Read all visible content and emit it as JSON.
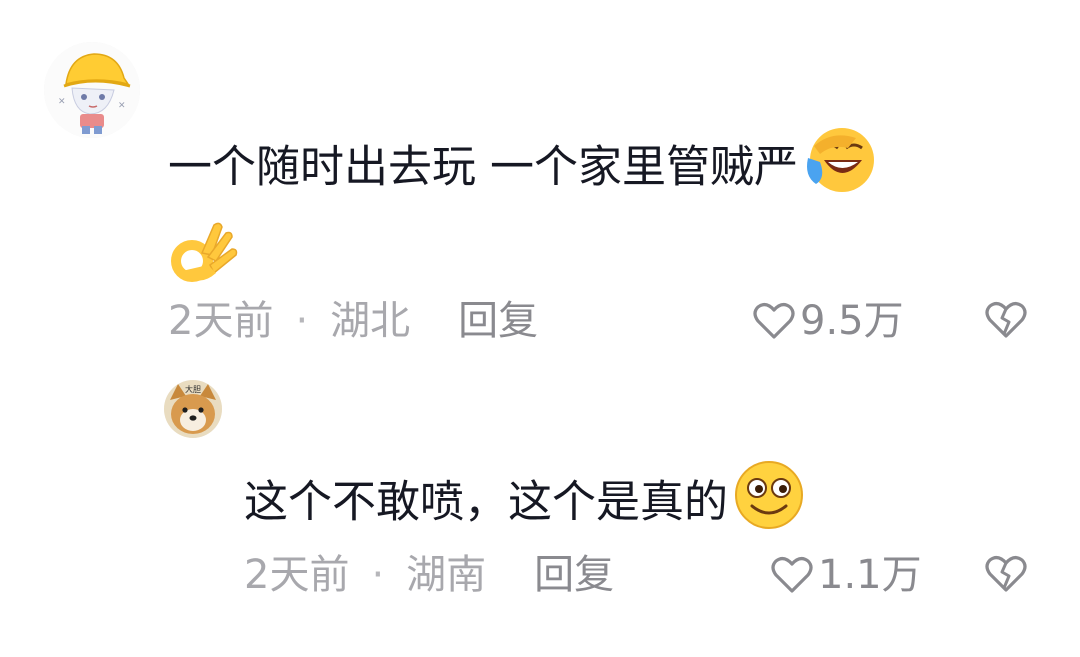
{
  "comments": [
    {
      "text": "一个随时出去玩 一个家里管贼严",
      "emojis": [
        "laughing-crying-emoji",
        "ok-hand-emoji"
      ],
      "time": "2天前",
      "location": "湖北",
      "reply_label": "回复",
      "likes": "9.5万"
    },
    {
      "text": "这个不敢喷，这个是真的",
      "emojis": [
        "smiling-face-emoji"
      ],
      "time": "2天前",
      "location": "湖南",
      "reply_label": "回复",
      "likes": "1.1万"
    }
  ],
  "avatar_caption": "大胆",
  "colors": {
    "text": "#161823",
    "meta": "#a8a8ad",
    "icon": "#8a8a8f",
    "emoji_yellow": "#ffc83d"
  }
}
